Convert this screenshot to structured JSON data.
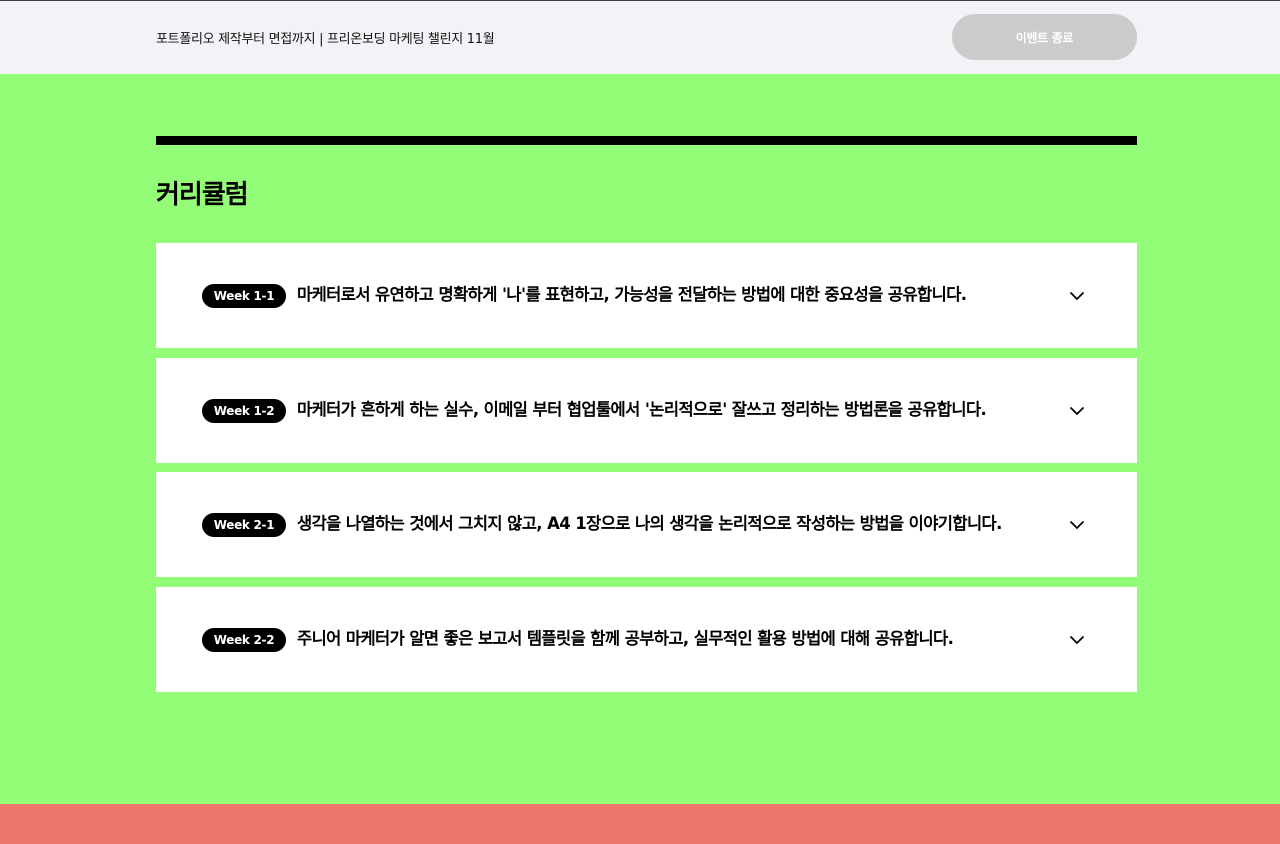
{
  "header": {
    "title": "포트폴리오 제작부터 면접까지 | 프리온보딩 마케팅 챌린지 11월",
    "event_button_label": "이벤트 종료"
  },
  "section": {
    "title": "커리큘럼"
  },
  "curriculum": {
    "items": [
      {
        "week": "Week 1-1",
        "text": "마케터로서 유연하고 명확하게 '나'를 표현하고, 가능성을 전달하는 방법에 대한 중요성을 공유합니다."
      },
      {
        "week": "Week 1-2",
        "text": "마케터가 흔하게 하는 실수, 이메일 부터 협업툴에서 '논리적으로' 잘쓰고 정리하는 방법론을 공유합니다."
      },
      {
        "week": "Week 2-1",
        "text": "생각을 나열하는 것에서 그치지 않고, A4 1장으로 나의 생각을 논리적으로 작성하는 방법을 이야기합니다."
      },
      {
        "week": "Week 2-2",
        "text": "주니어 마케터가 알면 좋은 보고서 템플릿을 함께 공부하고, 실무적인 활용 방법에 대해 공유합니다."
      }
    ]
  },
  "colors": {
    "background": "#94fd78",
    "header_bg": "#f2f3f6",
    "footer_band": "#ed756c",
    "badge_bg": "#000000",
    "button_disabled": "#cbcbcb"
  }
}
